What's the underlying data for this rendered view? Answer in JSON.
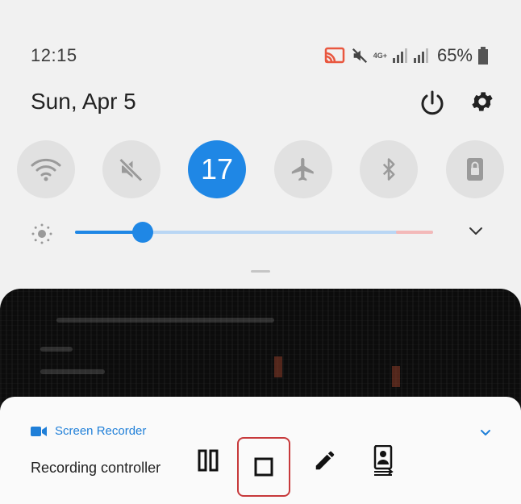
{
  "status_bar": {
    "time": "12:15",
    "network_label": "4G+",
    "battery_percent": "65%"
  },
  "header": {
    "date": "Sun, Apr 5"
  },
  "quick_tiles": [
    {
      "name": "wifi",
      "icon": "wifi-icon",
      "active": false
    },
    {
      "name": "sound",
      "icon": "mute-icon",
      "active": false
    },
    {
      "name": "number",
      "label": "17",
      "active": true
    },
    {
      "name": "airplane",
      "icon": "airplane-icon",
      "active": false
    },
    {
      "name": "bluetooth",
      "icon": "bluetooth-icon",
      "active": false
    },
    {
      "name": "rotation-lock",
      "icon": "lock-icon",
      "active": false
    }
  ],
  "brightness": {
    "level": 0.19
  },
  "notification": {
    "app_name": "Screen Recorder",
    "title": "Recording controller",
    "controls": [
      "pause-icon",
      "stop-icon",
      "pencil-icon",
      "selfie-icon"
    ]
  },
  "colors": {
    "accent": "#1f87e5",
    "tile_bg": "#e1e1e1",
    "highlight": "#c7393b"
  }
}
